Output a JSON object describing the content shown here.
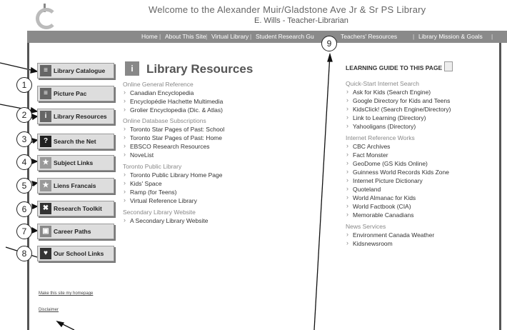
{
  "header": {
    "title": "Welcome to the Alexander Muir/Gladstone Ave Jr & Sr PS   Library",
    "subtitle": "E. Wills - Teacher-Librarian"
  },
  "nav": [
    "Home",
    "About This Site",
    "Virtual Library",
    "Student Research Gu",
    "Teachers' Resources",
    "Library Mission & Goals"
  ],
  "sidebar": {
    "buttons": [
      {
        "label": "Library Catalogue",
        "icon": "book-icon"
      },
      {
        "label": "Picture Pac",
        "icon": "book-icon"
      },
      {
        "label": "Library Resources",
        "icon": "info-icon"
      },
      {
        "label": "Search the Net",
        "icon": "question-icon"
      },
      {
        "label": "Subject Links",
        "icon": "star-icon"
      },
      {
        "label": "Liens Francais",
        "icon": "star-icon"
      },
      {
        "label": "Research Toolkit",
        "icon": "tools-icon"
      },
      {
        "label": "Career Paths",
        "icon": "frame-icon"
      },
      {
        "label": "Our School Links",
        "icon": "shield-icon"
      }
    ],
    "homepage_link": "Make this site my homepage",
    "disclaimer_link": "Disclaimer"
  },
  "main": {
    "title": "Library Resources",
    "sections": [
      {
        "heading": "Online General Reference",
        "items": [
          "Canadian Encyclopedia",
          "Encyclopédie Hachette Multimedia",
          "Grolier Encyclopedia (Dic. & Atlas)"
        ]
      },
      {
        "heading": "Online Database Subscriptions",
        "items": [
          "Toronto Star Pages of Past: School",
          "Toronto Star Pages of Past: Home",
          "EBSCO Research Resources",
          "NoveList"
        ]
      },
      {
        "heading": "Toronto Public Library",
        "items": [
          "Toronto Public Library Home Page",
          "Kids' Space",
          "Ramp (for Teens)",
          "Virtual Reference Library"
        ]
      },
      {
        "heading": "Secondary Library Website",
        "items": [
          "A Secondary Library Website"
        ]
      }
    ]
  },
  "guide": {
    "title": "LEARNING GUIDE TO THIS PAGE",
    "sections": [
      {
        "heading": "Quick-Start Internet Search",
        "items": [
          "Ask for Kids (Search Engine)",
          "Google Directory for Kids and Teens",
          "KidsClick! (Search Engine/Directory)",
          "Link to Learning (Directory)",
          "Yahooligans (Directory)"
        ]
      },
      {
        "heading": "Internet Reference Works",
        "items": [
          "CBC Archives",
          "Fact Monster",
          "GeoDome (GS Kids Online)",
          "Guinness World Records Kids Zone",
          "Internet Picture Dictionary",
          "Quoteland",
          "World Almanac for Kids",
          "World Factbook (CIA)",
          "Memorable Canadians"
        ]
      },
      {
        "heading": "News Services",
        "items": [
          "Environment Canada Weather",
          "Kidsnewsroom"
        ]
      }
    ]
  },
  "callouts": [
    "1",
    "2",
    "3",
    "4",
    "5",
    "6",
    "7",
    "8",
    "9"
  ]
}
